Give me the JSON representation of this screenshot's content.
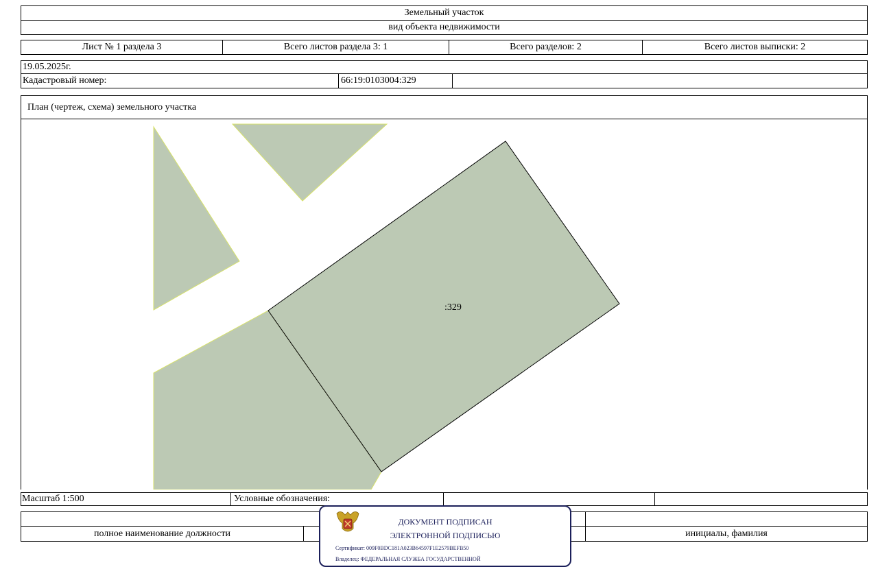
{
  "header": {
    "title": "Земельный участок",
    "subtitle": "вид объекта недвижимости"
  },
  "sheet_info": {
    "sheet": "Лист № 1 раздела 3",
    "total_sheets_section": "Всего листов раздела 3: 1",
    "total_sections": "Всего разделов: 2",
    "total_sheets_extract": "Всего листов выписки: 2"
  },
  "meta": {
    "date": "19.05.2025г.",
    "cadastral_label": "Кадастровый номер:",
    "cadastral_number": "66:19:0103004:329"
  },
  "plan": {
    "title": "План (чертеж, схема) земельного участка",
    "parcel_label": ":329"
  },
  "footer": {
    "scale": "Масштаб 1:500",
    "legend_label": "Условные обозначения:",
    "position_caption": "полное наименование должности",
    "name_caption": "инициалы, фамилия"
  },
  "signature": {
    "line1": "ДОКУМЕНТ ПОДПИСАН",
    "line2": "ЭЛЕКТРОННОЙ ПОДПИСЬЮ",
    "certificate": "Сертификат: 009F0BDC181A023B64597F1E2579BEFB50",
    "owner": "Владелец: ФЕДЕРАЛЬНАЯ СЛУЖБА ГОСУДАРСТВЕННОЙ"
  },
  "colors": {
    "parcel_fill": "#bcc9b4",
    "neighbor_edge": "#d8e26a",
    "stamp_blue": "#1b1f5a"
  }
}
